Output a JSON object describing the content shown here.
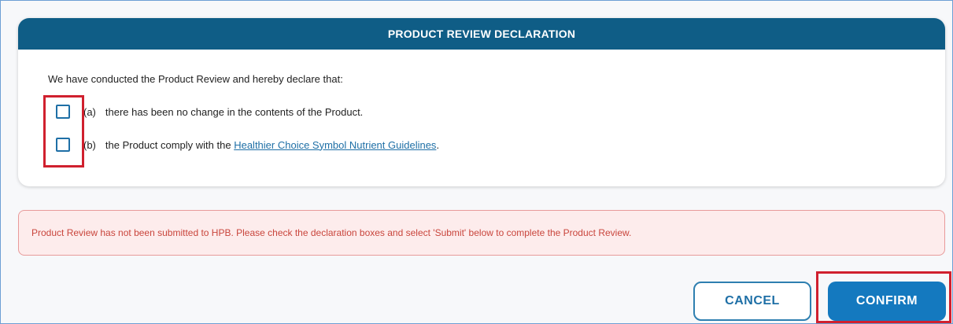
{
  "dialog": {
    "title": "PRODUCT REVIEW DECLARATION",
    "intro": "We have conducted the Product Review and hereby declare that:",
    "declarations": [
      {
        "marker": "(a)",
        "text": "there has been no change in the contents of the Product.",
        "checked": false
      },
      {
        "marker": "(b)",
        "text_before": "the Product comply with the ",
        "link": "Healthier Choice Symbol Nutrient Guidelines",
        "text_after": ".",
        "checked": false
      }
    ]
  },
  "alert": {
    "message": "Product Review has not been submitted to HPB. Please check the declaration boxes and select 'Submit' below to complete the Product Review."
  },
  "actions": {
    "cancel_label": "CANCEL",
    "confirm_label": "CONFIRM"
  },
  "colors": {
    "header_bg": "#0f5d86",
    "primary": "#1479bf",
    "link": "#1e6fa6",
    "alert_text": "#c9453c",
    "alert_bg": "#fdecec",
    "highlight": "#d0202e"
  }
}
